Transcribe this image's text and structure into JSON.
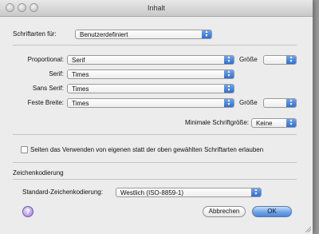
{
  "window": {
    "title": "Inhalt"
  },
  "fonts_for": {
    "label": "Schriftarten für:",
    "value": "Benutzerdefiniert"
  },
  "rows": [
    {
      "label": "Proportional:",
      "value": "Serif"
    },
    {
      "label": "Serif:",
      "value": "Times"
    },
    {
      "label": "Sans Serif:",
      "value": "Times"
    },
    {
      "label": "Feste Breite:",
      "value": "Times"
    }
  ],
  "size_label": "Größe",
  "size_label_2": "Größe",
  "min_size": {
    "label": "Minimale Schriftgröße:",
    "value": "Keine"
  },
  "checkbox_label": "Seiten das Verwenden von eigenen statt der oben gewählten Schriftarten erlauben",
  "encoding": {
    "section_title": "Zeichenkodierung",
    "label": "Standard-Zeichenkodierung:",
    "value": "Westlich (ISO-8859-1)"
  },
  "buttons": {
    "cancel": "Abbrechen",
    "ok": "OK",
    "help": "?"
  },
  "icons": {
    "popup_arrows": "updown-arrows-icon",
    "help": "help-icon"
  },
  "colors": {
    "accent": "#3d7bd9",
    "help_purple": "#9f7ad8"
  }
}
